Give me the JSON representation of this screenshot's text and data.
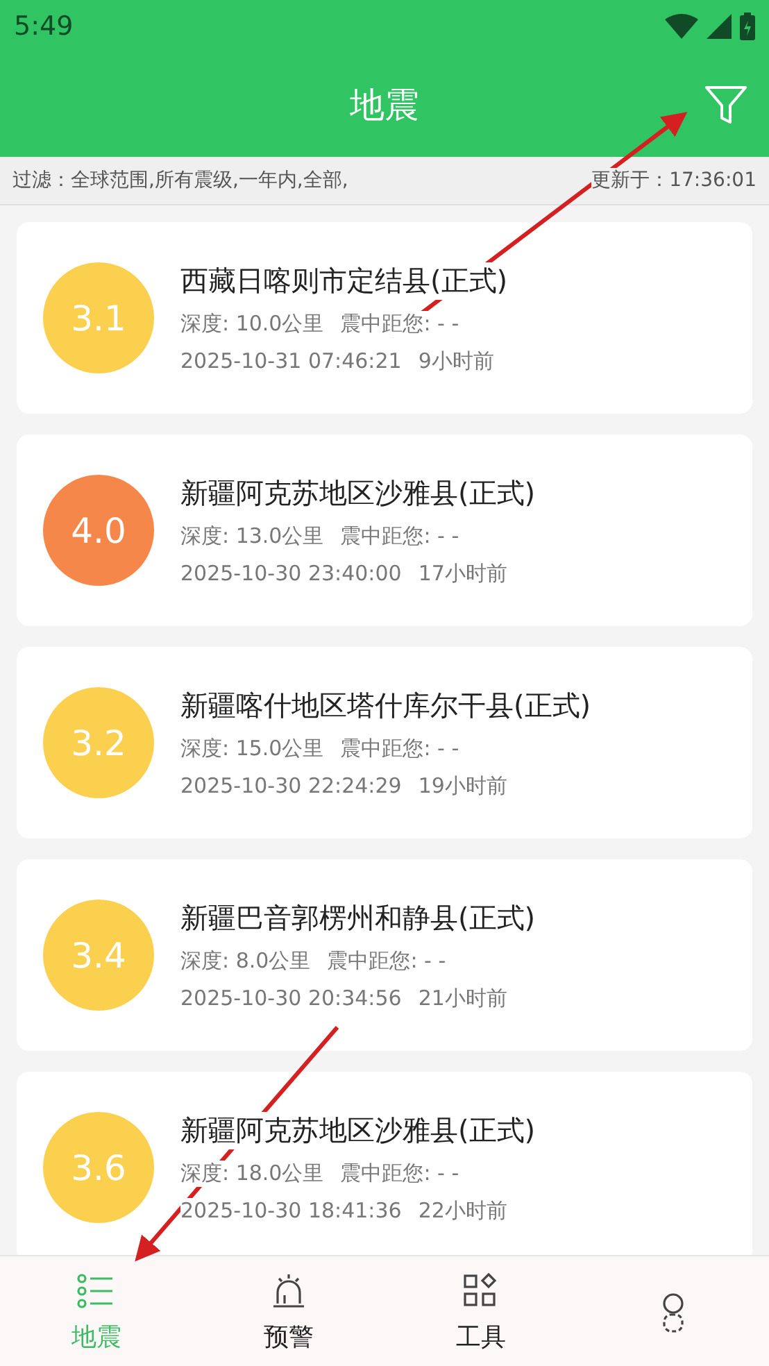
{
  "status_bar": {
    "time": "5:49"
  },
  "header": {
    "title": "地震"
  },
  "filter_bar": {
    "filter": "过滤：全球范围,所有震级,一年内,全部,",
    "updated": "更新于：17:36:01"
  },
  "quakes": [
    {
      "magnitude": "3.1",
      "color": "#fcd04f",
      "place": "西藏日喀则市定结县(正式)",
      "depth": "深度: 10.0公里",
      "distance": "震中距您: - -",
      "time": "2025-10-31 07:46:21",
      "ago": "9小时前"
    },
    {
      "magnitude": "4.0",
      "color": "#f6874b",
      "place": "新疆阿克苏地区沙雅县(正式)",
      "depth": "深度: 13.0公里",
      "distance": "震中距您: - -",
      "time": "2025-10-30 23:40:00",
      "ago": "17小时前"
    },
    {
      "magnitude": "3.2",
      "color": "#fcd04f",
      "place": "新疆喀什地区塔什库尔干县(正式)",
      "depth": "深度: 15.0公里",
      "distance": "震中距您: - -",
      "time": "2025-10-30 22:24:29",
      "ago": "19小时前"
    },
    {
      "magnitude": "3.4",
      "color": "#fcd04f",
      "place": "新疆巴音郭楞州和静县(正式)",
      "depth": "深度: 8.0公里",
      "distance": "震中距您: - -",
      "time": "2025-10-30 20:34:56",
      "ago": "21小时前"
    },
    {
      "magnitude": "3.6",
      "color": "#fcd04f",
      "place": "新疆阿克苏地区沙雅县(正式)",
      "depth": "深度: 18.0公里",
      "distance": "震中距您: - -",
      "time": "2025-10-30 18:41:36",
      "ago": "22小时前"
    }
  ],
  "nav": [
    {
      "kind": "list",
      "label": "地震",
      "selected": true
    },
    {
      "kind": "alarm",
      "label": "预警",
      "selected": false
    },
    {
      "kind": "tools",
      "label": "工具",
      "selected": false
    },
    {
      "kind": "person",
      "selected": false
    }
  ]
}
